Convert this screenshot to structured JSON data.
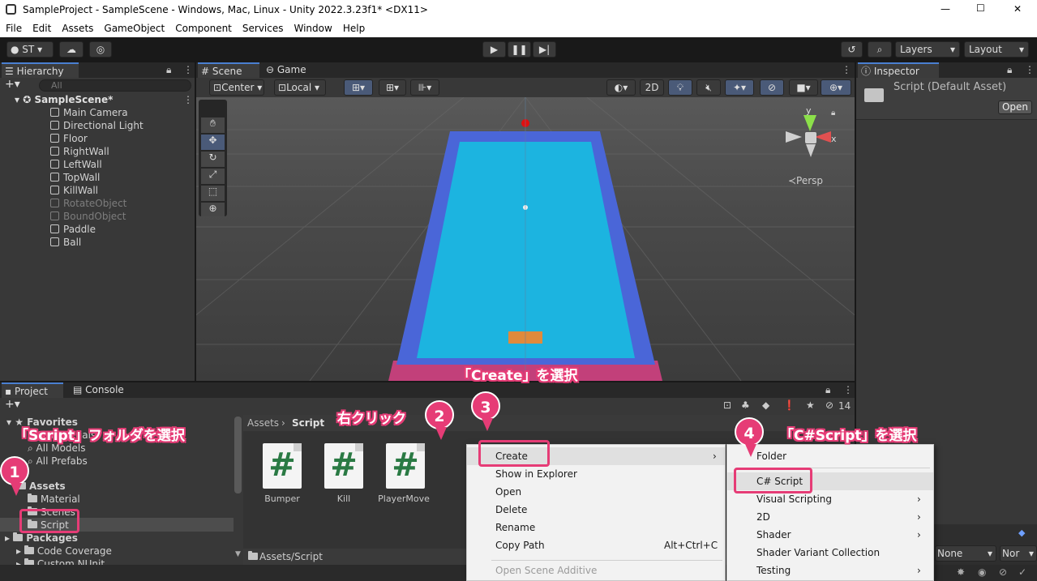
{
  "window": {
    "title": "SampleProject - SampleScene - Windows, Mac, Linux - Unity 2022.3.23f1* <DX11>",
    "min": "—",
    "max": "☐",
    "close": "✕"
  },
  "menu": [
    "File",
    "Edit",
    "Assets",
    "GameObject",
    "Component",
    "Services",
    "Window",
    "Help"
  ],
  "toolbar": {
    "account": "ST",
    "layers": "Layers",
    "layout": "Layout"
  },
  "hierarchy": {
    "tab": "Hierarchy",
    "search_placeholder": "All",
    "scene": "SampleScene*",
    "items": [
      {
        "name": "Main Camera",
        "dim": false
      },
      {
        "name": "Directional Light",
        "dim": false
      },
      {
        "name": "Floor",
        "dim": false
      },
      {
        "name": "RightWall",
        "dim": false
      },
      {
        "name": "LeftWall",
        "dim": false
      },
      {
        "name": "TopWall",
        "dim": false
      },
      {
        "name": "KillWall",
        "dim": false
      },
      {
        "name": "RotateObject",
        "dim": true
      },
      {
        "name": "BoundObject",
        "dim": true
      },
      {
        "name": "Paddle",
        "dim": false
      },
      {
        "name": "Ball",
        "dim": false
      }
    ]
  },
  "scene": {
    "tab_scene": "Scene",
    "tab_game": "Game",
    "pivot": "Center",
    "space": "Local",
    "mode_2d": "2D",
    "persp": "≺Persp",
    "axis_y": "y",
    "axis_x": "x"
  },
  "inspector": {
    "tab": "Inspector",
    "title": "Script (Default Asset)",
    "open": "Open",
    "none1": "None",
    "none2": "Nor"
  },
  "project": {
    "tab_project": "Project",
    "tab_console": "Console",
    "count": "14",
    "tree": {
      "favorites": "Favorites",
      "fav_items": [
        "All Materials",
        "All Models",
        "All Prefabs"
      ],
      "assets": "Assets",
      "asset_items": [
        "Material",
        "Scenes",
        "Script"
      ],
      "packages": "Packages",
      "package_items": [
        "Code Coverage",
        "Custom NUnit"
      ]
    },
    "breadcrumb_root": "Assets",
    "breadcrumb_sep": "›",
    "breadcrumb_current": "Script",
    "files": [
      "Bumper",
      "Kill",
      "PlayerMove"
    ],
    "path": "Assets/Script"
  },
  "context_menu": {
    "items": [
      {
        "label": "Create",
        "shortcut": "",
        "sub": true
      },
      {
        "label": "Show in Explorer",
        "shortcut": "",
        "sub": false
      },
      {
        "label": "Open",
        "shortcut": "",
        "sub": false
      },
      {
        "label": "Delete",
        "shortcut": "",
        "sub": false
      },
      {
        "label": "Rename",
        "shortcut": "",
        "sub": false
      },
      {
        "label": "Copy Path",
        "shortcut": "Alt+Ctrl+C",
        "sub": false
      },
      {
        "label": "Open Scene Additive",
        "shortcut": "",
        "sub": false,
        "disabled": true
      }
    ]
  },
  "submenu": {
    "items": [
      {
        "label": "Folder",
        "sub": false
      },
      {
        "label": "C# Script",
        "sub": false
      },
      {
        "label": "Visual Scripting",
        "sub": true
      },
      {
        "label": "2D",
        "sub": true
      },
      {
        "label": "Shader",
        "sub": true
      },
      {
        "label": "Shader Variant Collection",
        "sub": false
      },
      {
        "label": "Testing",
        "sub": true
      }
    ]
  },
  "annotations": {
    "note1": "「Script」フォルダを選択",
    "note2": "右クリック",
    "note3": "「Create」を選択",
    "note4": "「C#Script」を選択",
    "pin1": "1",
    "pin2": "2",
    "pin3": "3",
    "pin4": "4"
  },
  "colors": {
    "accent": "#e63c76",
    "floor": "#1cb4e0",
    "walls": "#4a66d8",
    "killwall": "#c2407a",
    "paddle": "#e08a3c"
  }
}
